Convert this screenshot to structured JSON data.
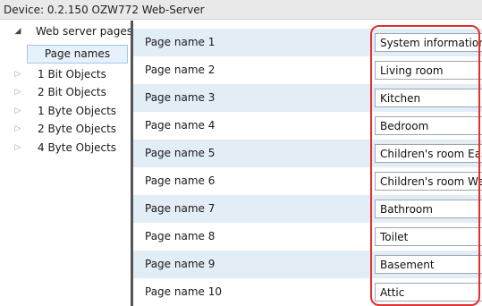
{
  "window": {
    "title": "Device: 0.2.150  OZW772 Web-Server"
  },
  "sidebar": {
    "items": [
      {
        "label": "Web server pages",
        "expanded": true
      },
      {
        "label": "1 Bit Objects",
        "expanded": false
      },
      {
        "label": "2 Bit Objects",
        "expanded": false
      },
      {
        "label": "1 Byte Objects",
        "expanded": false
      },
      {
        "label": "2 Byte Objects",
        "expanded": false
      },
      {
        "label": "4 Byte Objects",
        "expanded": false
      }
    ],
    "page_names_button": "Page names",
    "expanded_glyph": "◢",
    "collapsed_glyph": "▷"
  },
  "main": {
    "rows": [
      {
        "label": "Page name 1",
        "value": "System information"
      },
      {
        "label": "Page name 2",
        "value": "Living room"
      },
      {
        "label": "Page name 3",
        "value": "Kitchen"
      },
      {
        "label": "Page name 4",
        "value": "Bedroom"
      },
      {
        "label": "Page name 5",
        "value": "Children's room East"
      },
      {
        "label": "Page name 6",
        "value": "Children's room West"
      },
      {
        "label": "Page name 7",
        "value": "Bathroom"
      },
      {
        "label": "Page name 8",
        "value": "Toilet"
      },
      {
        "label": "Page name 9",
        "value": "Basement"
      },
      {
        "label": "Page name 10",
        "value": "Attic"
      }
    ]
  },
  "colors": {
    "row_alt": "#e3edf6",
    "highlight": "#e0302f",
    "splitter": "#555555",
    "button_bg": "#e6f1fb"
  }
}
